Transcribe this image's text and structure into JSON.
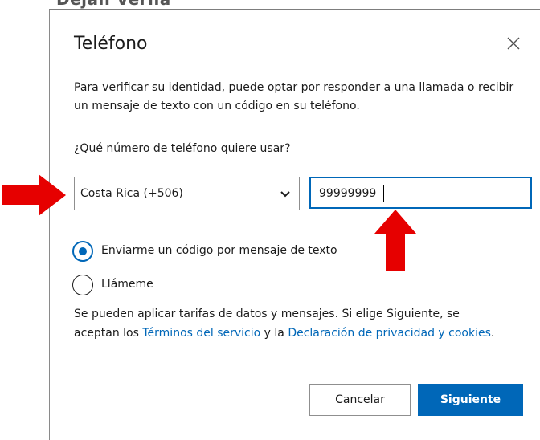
{
  "background": {
    "partial_text": "Dejan Verna"
  },
  "dialog": {
    "title": "Teléfono",
    "description": "Para verificar su identidad, puede optar por responder a una llamada o recibir un mensaje de texto con un código en su teléfono.",
    "question": "¿Qué número de teléfono quiere usar?",
    "country_select": {
      "value": "Costa Rica (+506)"
    },
    "phone_input": {
      "value": "99999999"
    },
    "radio_options": [
      {
        "label": "Enviarme un código por mensaje de texto",
        "checked": true
      },
      {
        "label": "Llámeme",
        "checked": false
      }
    ],
    "footer": {
      "text_before": "Se pueden aplicar tarifas de datos y mensajes. Si elige Siguiente, se aceptan los ",
      "terms_link": "Términos del servicio",
      "text_middle": " y la ",
      "privacy_link": "Declaración de privacidad y cookies",
      "text_after": "."
    },
    "buttons": {
      "cancel": "Cancelar",
      "next": "Siguiente"
    }
  },
  "colors": {
    "accent": "#0067b8",
    "annotation_arrow": "#e60000",
    "text": "#1b1b1b"
  },
  "icons": {
    "close": "close-icon",
    "dropdown": "chevron-down-icon",
    "annotation": "red-arrow-icon"
  }
}
